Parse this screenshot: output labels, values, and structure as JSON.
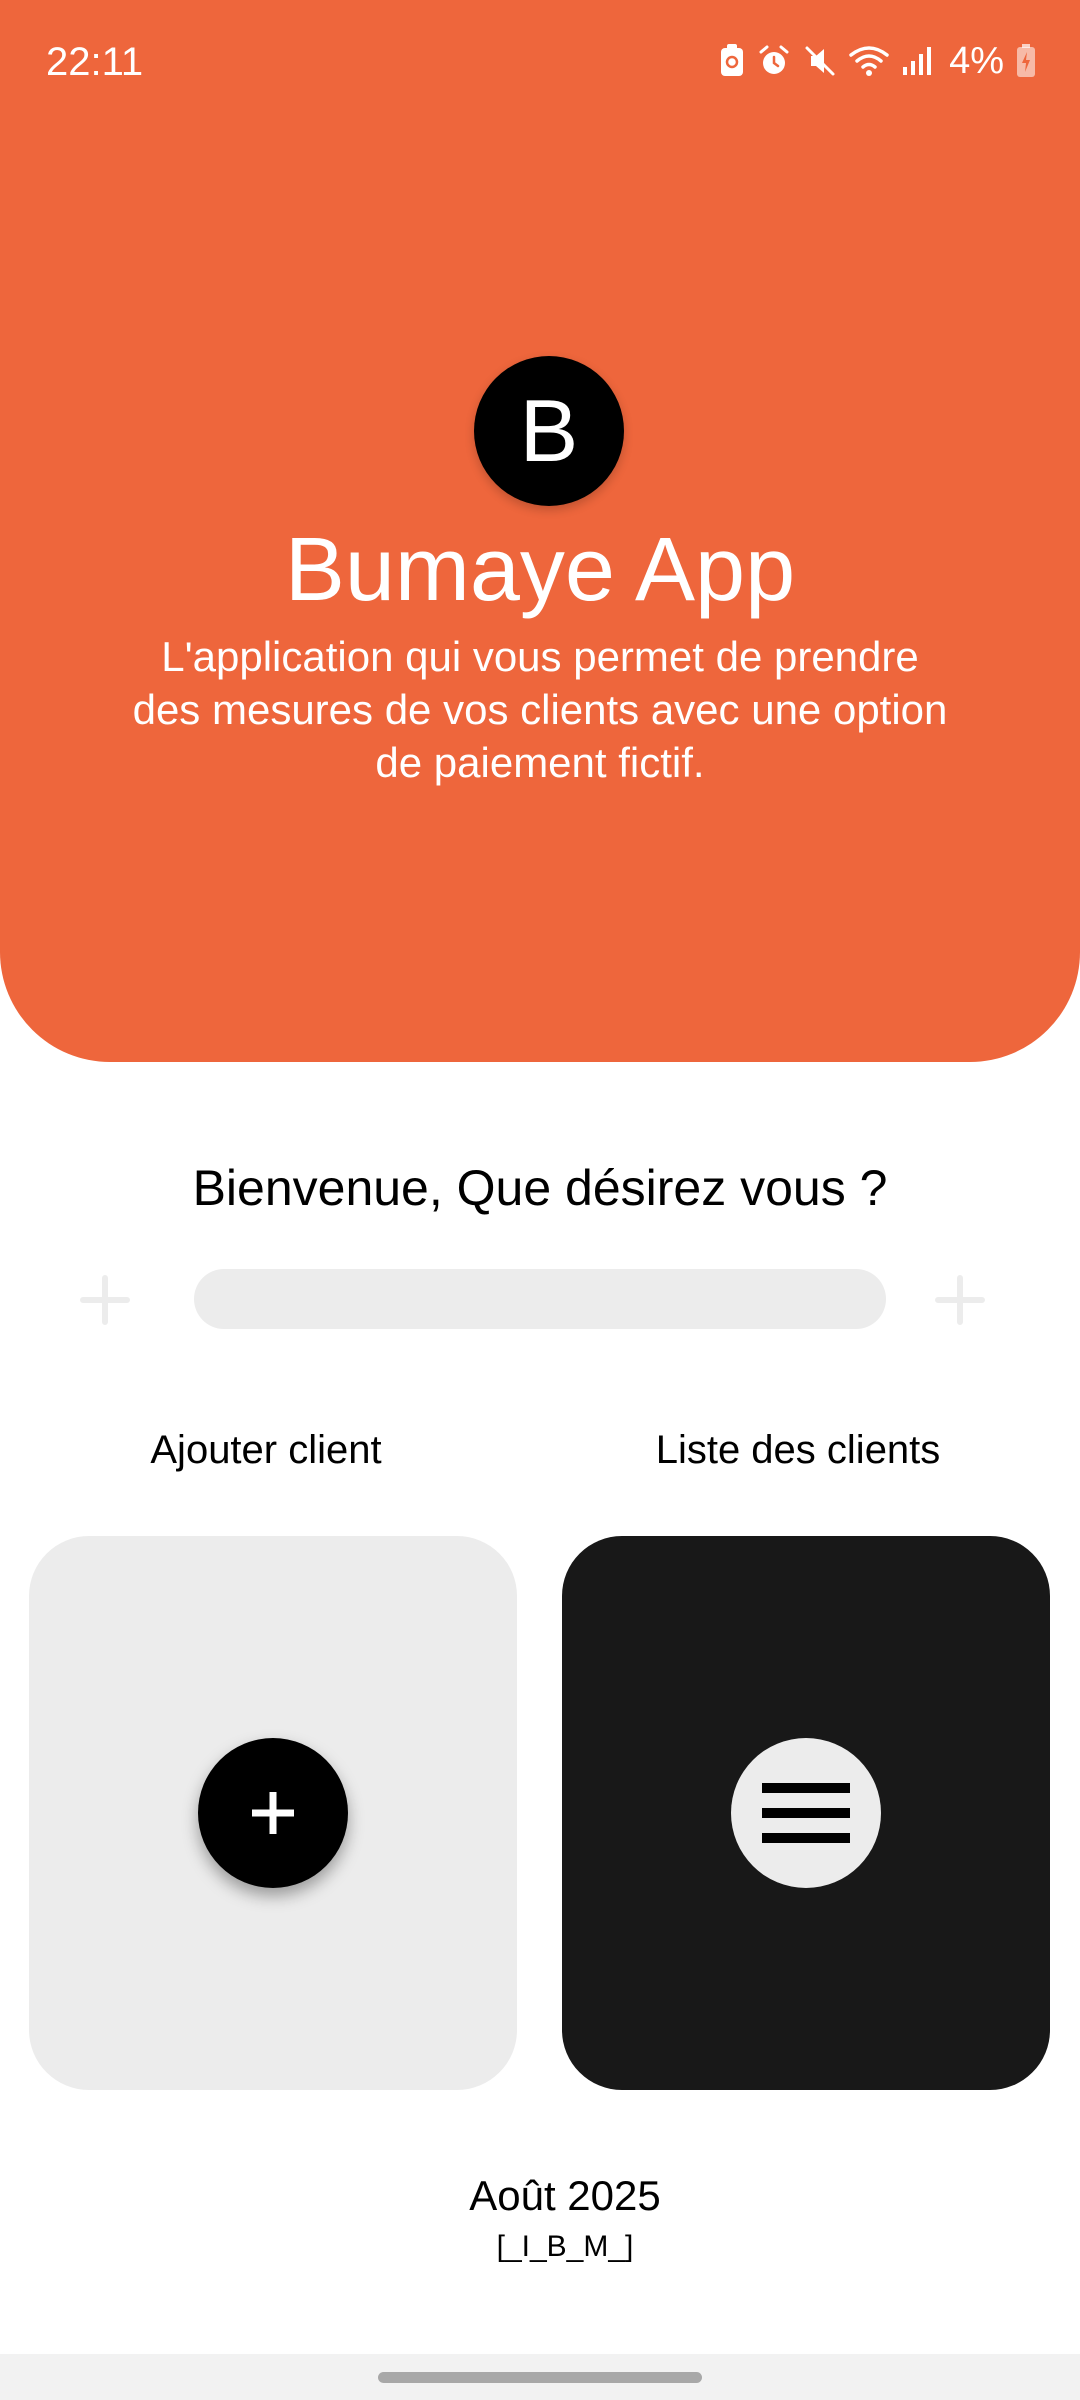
{
  "status_bar": {
    "time": "22:11",
    "battery_percent": "4%",
    "icons": [
      "usb-debug-icon",
      "alarm-icon",
      "mute-icon",
      "wifi-icon",
      "signal-icon",
      "battery-charging-icon"
    ]
  },
  "hero": {
    "logo_letter": "B",
    "title": "Bumaye App",
    "description": "L'application qui vous permet de prendre des mesures de vos clients avec une option de paiement fictif.",
    "background_color": "#EE663C"
  },
  "main": {
    "welcome": "Bienvenue, Que désirez vous ?",
    "cards": [
      {
        "label": "Ajouter client",
        "icon": "plus-icon"
      },
      {
        "label": "Liste des clients",
        "icon": "menu-icon"
      }
    ]
  },
  "footer": {
    "date": "Août 2025",
    "signature": "[_I_B_M_]"
  }
}
